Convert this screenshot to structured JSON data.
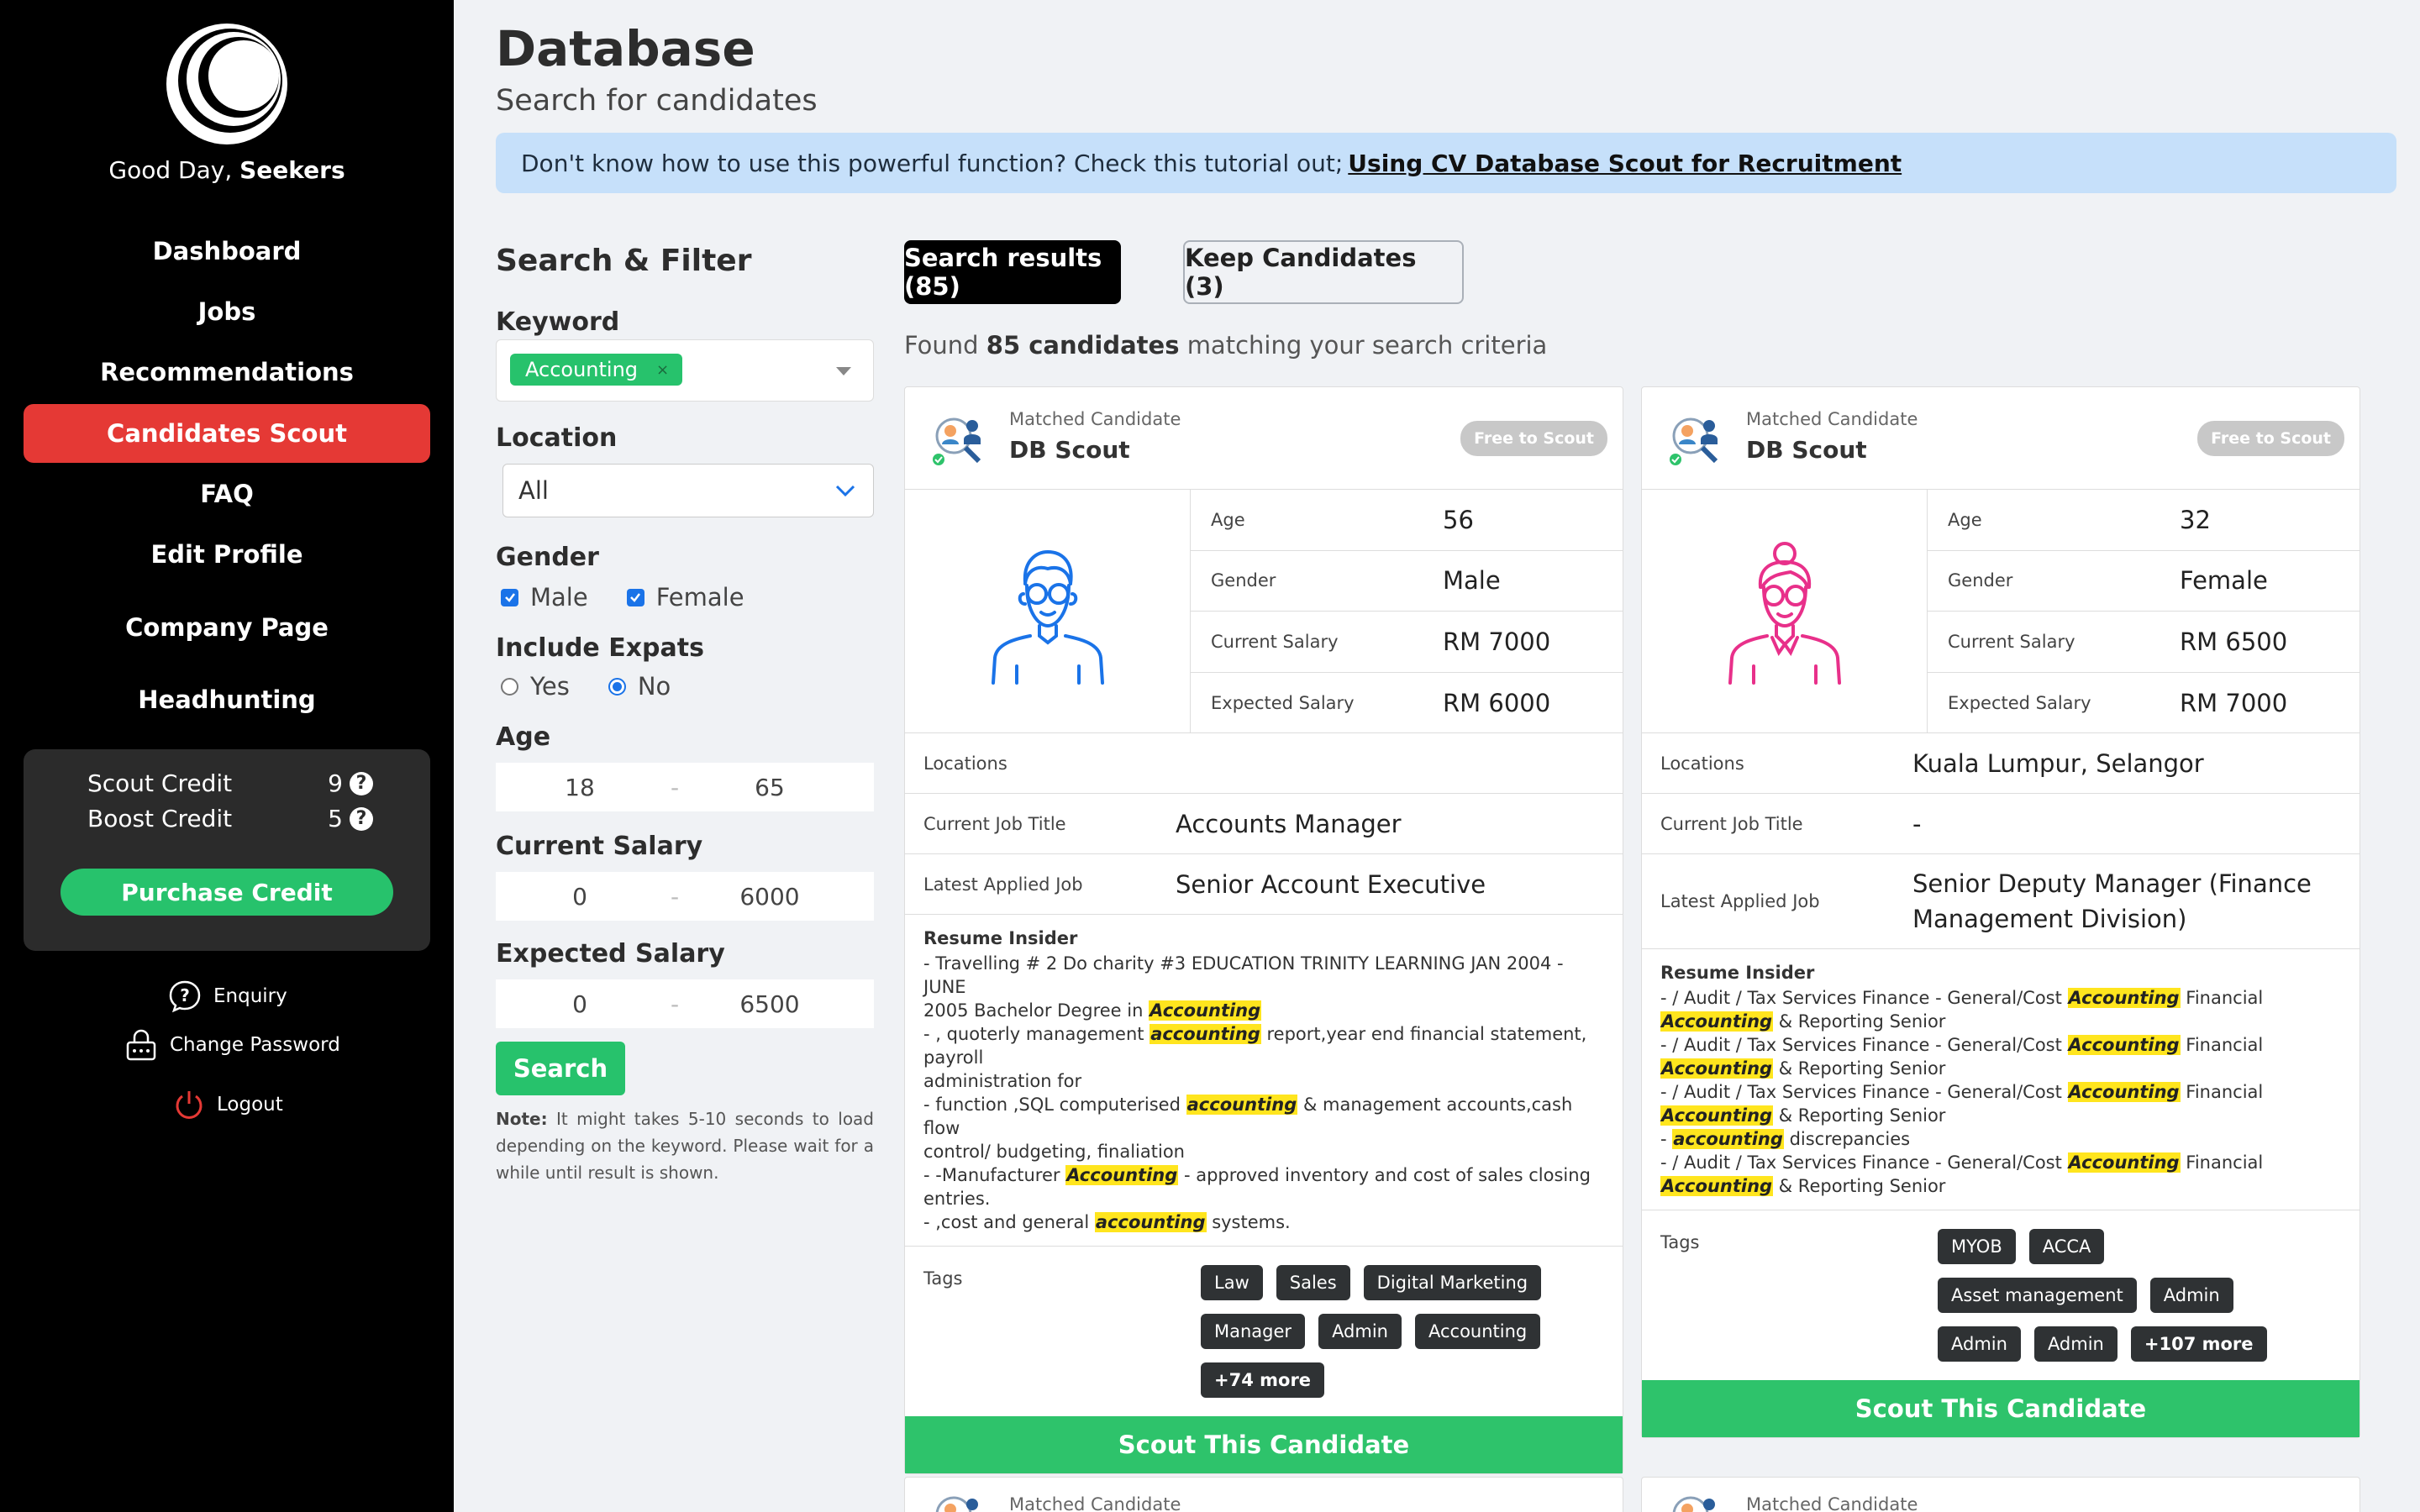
{
  "sidebar": {
    "greeting_prefix": "Good Day,",
    "greeting_name": "Seekers",
    "nav": [
      {
        "label": "Dashboard"
      },
      {
        "label": "Jobs"
      },
      {
        "label": "Recommendations"
      },
      {
        "label": "Candidates Scout",
        "active": true
      },
      {
        "label": "FAQ"
      },
      {
        "label": "Edit Profile"
      },
      {
        "label": "Company Page"
      },
      {
        "label": "Headhunting"
      }
    ],
    "credits": {
      "scout_label": "Scout Credit",
      "scout_value": "9",
      "boost_label": "Boost Credit",
      "boost_value": "5",
      "purchase_label": "Purchase Credit"
    },
    "links": {
      "enquiry": "Enquiry",
      "change_password": "Change Password",
      "logout": "Logout"
    }
  },
  "header": {
    "title": "Database",
    "subtitle": "Search for candidates"
  },
  "banner": {
    "text": "Don't know how to use this powerful function? Check this tutorial out;",
    "link": "Using CV Database Scout for Recruitment"
  },
  "filter": {
    "title": "Search & Filter",
    "keyword_label": "Keyword",
    "keyword_chip": "Accounting",
    "keyword_remove": "×",
    "location_label": "Location",
    "location_value": "All",
    "gender_label": "Gender",
    "gender_male": "Male",
    "gender_female": "Female",
    "expats_label": "Include Expats",
    "expats_yes": "Yes",
    "expats_no": "No",
    "age_label": "Age",
    "age_min": "18",
    "age_max": "65",
    "current_salary_label": "Current Salary",
    "current_min": "0",
    "current_max": "6000",
    "expected_salary_label": "Expected Salary",
    "expected_min": "0",
    "expected_max": "6500",
    "range_sep": "-",
    "search_label": "Search",
    "note_bold": "Note:",
    "note_text": "It might takes 5-10 seconds to load depending on the keyword. Please wait for a while until result is shown."
  },
  "results": {
    "tab_results": "Search results (85)",
    "tab_keep": "Keep Candidates (3)",
    "found_prefix": "Found",
    "found_count": "85 candidates",
    "found_suffix": "matching your search criteria",
    "cards": [
      {
        "matched": "Matched Candidate",
        "source": "DB Scout",
        "badge": "Free to Scout",
        "age_label": "Age",
        "age": "56",
        "gender_label": "Gender",
        "gender": "Male",
        "current_label": "Current Salary",
        "current": "RM 7000",
        "expected_label": "Expected Salary",
        "expected": "RM 6000",
        "locations_label": "Locations",
        "locations": "",
        "job_title_label": "Current Job Title",
        "job_title": "Accounts Manager",
        "applied_label": "Latest Applied Job",
        "applied": "Senior Account Executive",
        "resume_title": "Resume Insider",
        "tags_label": "Tags",
        "tags": [
          "Law",
          "Sales",
          "Digital Marketing",
          "Manager",
          "Admin",
          "Accounting"
        ],
        "more": "+74 more",
        "scout_label": "Scout This Candidate"
      },
      {
        "matched": "Matched Candidate",
        "source": "DB Scout",
        "badge": "Free to Scout",
        "age_label": "Age",
        "age": "32",
        "gender_label": "Gender",
        "gender": "Female",
        "current_label": "Current Salary",
        "current": "RM 6500",
        "expected_label": "Expected Salary",
        "expected": "RM 7000",
        "locations_label": "Locations",
        "locations": "Kuala Lumpur, Selangor",
        "job_title_label": "Current Job Title",
        "job_title": "-",
        "applied_label": "Latest Applied Job",
        "applied": "Senior Deputy Manager (Finance Management Division)",
        "resume_title": "Resume Insider",
        "tags_label": "Tags",
        "tags": [
          "MYOB",
          "ACCA",
          "Asset management",
          "Admin",
          "Admin",
          "Admin"
        ],
        "more": "+107 more",
        "scout_label": "Scout This Candidate"
      }
    ],
    "stub_matched": "Matched Candidate"
  },
  "resume1": {
    "l1": "- Travelling # 2 Do charity #3 EDUCATION TRINITY LEARNING JAN 2004 -JUNE",
    "l2a": "2005 Bachelor Degree in",
    "l2m": "Accounting",
    "l3a": "- , quoterly management",
    "l3m": "accounting",
    "l3b": "report,year end financial statement, payroll",
    "l4": "administration for",
    "l5a": "- function ,SQL computerised",
    "l5m": "accounting",
    "l5b": "& management accounts,cash flow",
    "l6": "control/ budgeting, finaliation",
    "l7a": "- -Manufacturer",
    "l7m": "Accounting",
    "l7b": "- approved inventory and cost of sales closing",
    "l8": "entries.",
    "l9a": "- ,cost and general",
    "l9m": "accounting",
    "l9b": "systems."
  },
  "resume2": {
    "a": "- / Audit / Tax Services Finance - General/Cost",
    "am": "Accounting",
    "b": "Financial",
    "cm": "Accounting",
    "c": "& Reporting Senior",
    "dm": "accounting",
    "d": "discrepancies"
  },
  "colors": {
    "accent_red": "#e53935",
    "accent_green": "#27c26c",
    "banner_blue": "#c6e0fa",
    "male_icon": "#1a73e8",
    "female_icon": "#e8308a",
    "highlight": "#ffe51e"
  },
  "icons": {
    "logo": "crescent-logo-icon",
    "help": "question-circle-icon",
    "enquiry": "question-bubble-icon",
    "password": "lock-icon",
    "logout": "power-icon",
    "chevron": "chevron-down-icon",
    "male_avatar": "male-avatar-icon",
    "female_avatar": "female-avatar-icon",
    "scout": "scout-people-icon"
  }
}
